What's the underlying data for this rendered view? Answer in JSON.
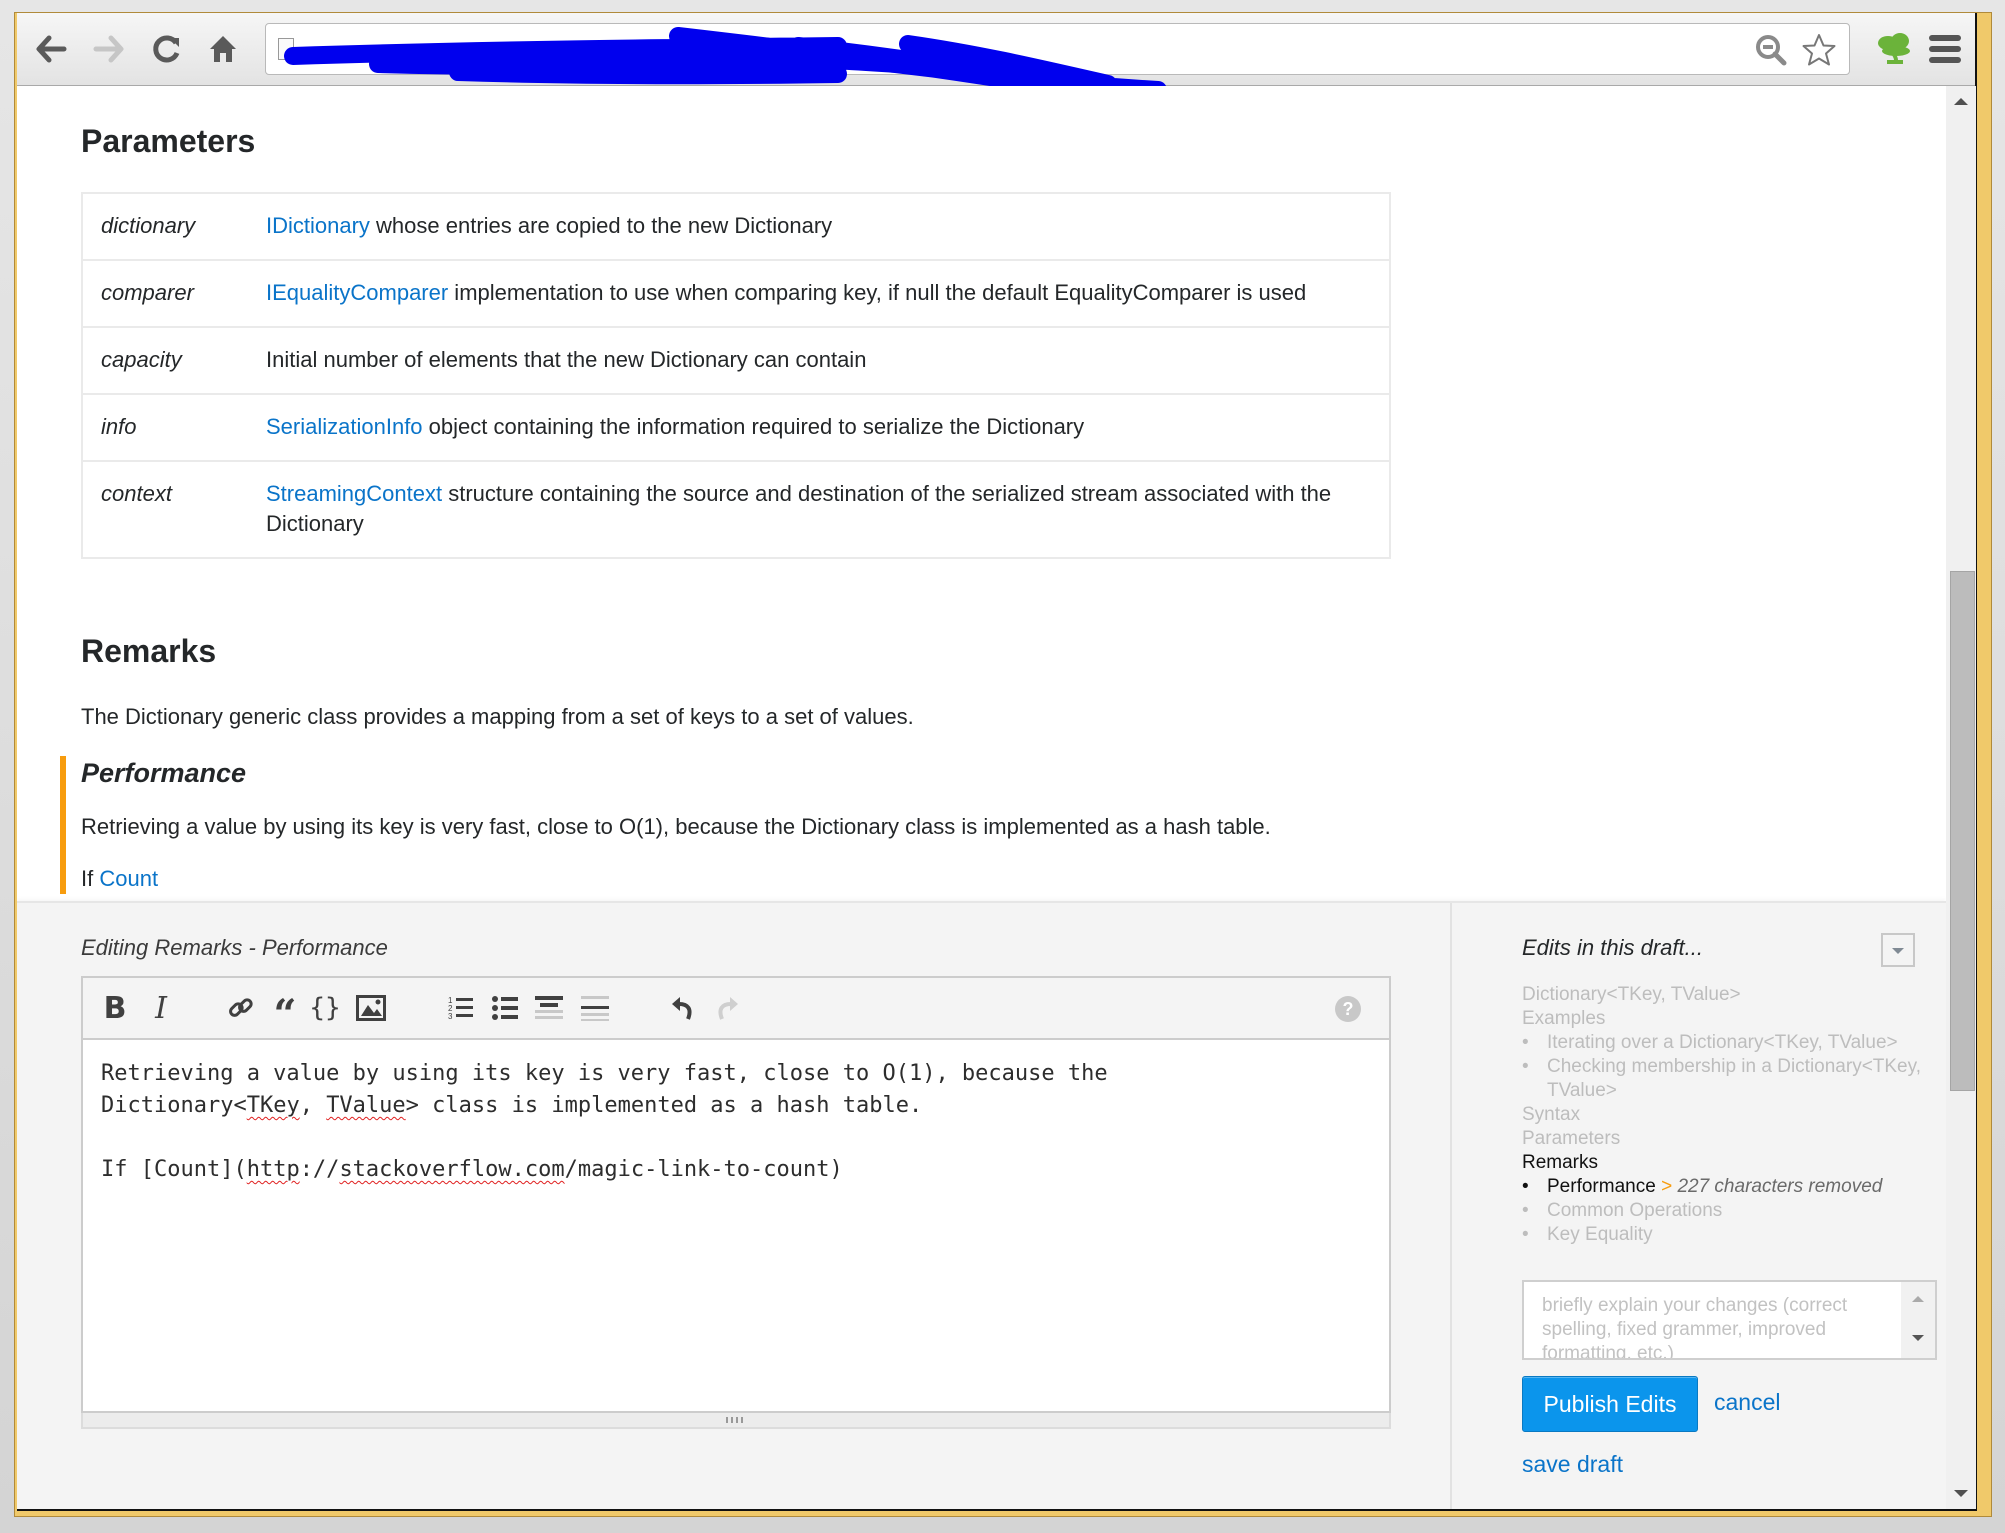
{
  "browser": {
    "back_label": "Back",
    "forward_label": "Forward",
    "reload_label": "Reload",
    "home_label": "Home",
    "url": "",
    "url_redacted": true
  },
  "parameters": {
    "heading": "Parameters",
    "rows": [
      {
        "name": "dictionary",
        "link": "IDictionary",
        "text": " whose entries are copied to the new Dictionary"
      },
      {
        "name": "comparer",
        "link": "IEqualityComparer",
        "text": " implementation to use when comparing key, if null the default EqualityComparer is used"
      },
      {
        "name": "capacity",
        "link": "",
        "text": "Initial number of elements that the new Dictionary can contain"
      },
      {
        "name": "info",
        "link": "SerializationInfo",
        "text": " object containing the information required to serialize the Dictionary"
      },
      {
        "name": "context",
        "link": "StreamingContext",
        "text": " structure containing the source and destination of the serialized stream associated with the Dictionary"
      }
    ]
  },
  "remarks": {
    "heading": "Remarks",
    "paragraph": "The Dictionary generic class provides a mapping from a set of keys to a set of values.",
    "performance": {
      "heading": "Performance",
      "paragraph": "Retrieving a value by using its key is very fast, close to O(1), because the Dictionary class is implemented as a hash table.",
      "if_prefix": "If ",
      "if_link": "Count"
    }
  },
  "editor": {
    "label": "Editing Remarks - Performance",
    "toolbar": {
      "bold": "B",
      "italic": "I",
      "help": "?"
    },
    "text": {
      "line1": "Retrieving a value by using its key is very fast, close to O(1), because the",
      "line2_a": "Dictionary<",
      "line2_b": "TKey",
      "line2_c": ", ",
      "line2_d": "TValue",
      "line2_e": "> class is implemented as a hash table.",
      "line4_a": "If [Count](",
      "line4_b": "http",
      "line4_c": "://",
      "line4_d": "stackoverflow.com",
      "line4_e": "/magic-link-to-count)"
    }
  },
  "edits_panel": {
    "title": "Edits in this draft...",
    "toc": [
      {
        "label": "Dictionary<TKey, TValue>",
        "level": 0
      },
      {
        "label": "Examples",
        "level": 0
      },
      {
        "label": "Iterating over a Dictionary<TKey, TValue>",
        "level": 1
      },
      {
        "label": "Checking membership in a Dictionary<TKey, TValue>",
        "level": 1
      },
      {
        "label": "Syntax",
        "level": 0
      },
      {
        "label": "Parameters",
        "level": 0
      },
      {
        "label": "Remarks",
        "level": 0,
        "active": true
      },
      {
        "label": "Performance",
        "level": 1,
        "active": true,
        "arrow": ">",
        "note": "227 characters removed"
      },
      {
        "label": "Common Operations",
        "level": 1
      },
      {
        "label": "Key Equality",
        "level": 1
      }
    ],
    "summary_placeholder": "briefly explain your changes (correct spelling, fixed grammer, improved formatting, etc.)",
    "publish_label": "Publish Edits",
    "cancel_label": "cancel",
    "save_draft_label": "save draft"
  },
  "colors": {
    "link": "#0a74c9",
    "accent_orange": "#f79c0e",
    "publish_blue": "#0b95ec",
    "window_border": "#f0c96a"
  }
}
